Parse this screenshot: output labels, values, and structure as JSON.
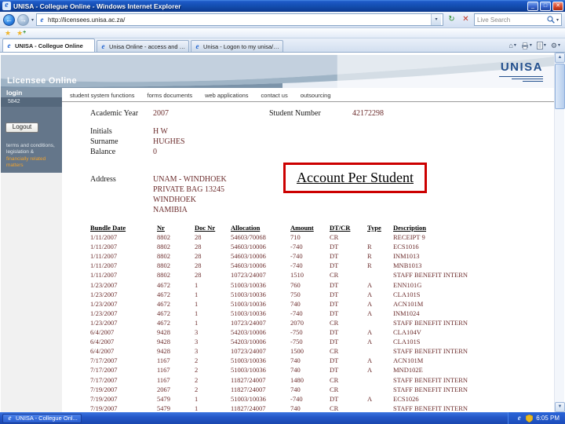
{
  "window": {
    "title": "UNISA - Collegue Online - Windows Internet Explorer"
  },
  "icons": {
    "minimize": "_",
    "maximize": "□",
    "close": "✕",
    "back": "←",
    "forward": "→",
    "dropdown": "▾",
    "refresh": "↻",
    "stop": "✕",
    "star": "★",
    "plus": "+",
    "home": "⌂",
    "gear": "⚙",
    "up": "▲",
    "down": "▼",
    "ie": "e"
  },
  "chrome": {
    "url": "http://licensees.unisa.ac.za/",
    "search_placeholder": "Live Search",
    "tabs": [
      {
        "label": "UNISA - Collegue Online",
        "active": true
      },
      {
        "label": "Unisa Online - access and regist...",
        "active": false
      },
      {
        "label": "Unisa - Logon to my unisa/colle...",
        "active": false
      }
    ]
  },
  "banner": {
    "site_title": "Licensee Online",
    "logo_text": "UNISA"
  },
  "sidebar": {
    "login_label": "login",
    "user_code": "5842",
    "logout_label": "Logout",
    "terms_line1": "terms and conditions,",
    "terms_line2": "legislation &",
    "terms_link": "financially related matters"
  },
  "nav": {
    "items": [
      "student system functions",
      "forms documents",
      "web applications",
      "contact us",
      "outsourcing"
    ]
  },
  "student": {
    "academic_year_label": "Academic Year",
    "academic_year": "2007",
    "student_number_label": "Student Number",
    "student_number": "42172298",
    "initials_label": "Initials",
    "initials": "H W",
    "surname_label": "Surname",
    "surname": "HUGHES",
    "balance_label": "Balance",
    "balance": "0",
    "address_label": "Address",
    "address_lines": [
      "UNAM - WINDHOEK",
      "PRIVATE BAG 13245",
      "WINDHOEK",
      "NAMIBIA"
    ]
  },
  "account_title": "Account Per Student",
  "table": {
    "headers": [
      "Bundle Date",
      "Nr",
      "Doc Nr",
      "Allocation",
      "Amount",
      "DT/CR",
      "Type",
      "Description"
    ],
    "rows": [
      [
        "1/11/2007",
        "8802",
        "28",
        "54603/70068",
        "710",
        "CR",
        "",
        "RECEIPT 9"
      ],
      [
        "1/11/2007",
        "8802",
        "28",
        "54603/10006",
        "-740",
        "DT",
        "R",
        "ECS1016"
      ],
      [
        "1/11/2007",
        "8802",
        "28",
        "54603/10006",
        "-740",
        "DT",
        "R",
        "INM1013"
      ],
      [
        "1/11/2007",
        "8802",
        "28",
        "54603/10006",
        "-740",
        "DT",
        "R",
        "MNB1013"
      ],
      [
        "1/11/2007",
        "8802",
        "28",
        "10723/24007",
        "1510",
        "CR",
        "",
        "STAFF BENEFIT INTERN"
      ],
      [
        "1/23/2007",
        "4672",
        "1",
        "51003/10036",
        "760",
        "DT",
        "A",
        "ENN101G"
      ],
      [
        "1/23/2007",
        "4672",
        "1",
        "51003/10036",
        "750",
        "DT",
        "A",
        "CLA101S"
      ],
      [
        "1/23/2007",
        "4672",
        "1",
        "51003/10036",
        "740",
        "DT",
        "A",
        "ACN101M"
      ],
      [
        "1/23/2007",
        "4672",
        "1",
        "51003/10036",
        "-740",
        "DT",
        "A",
        "INM1024"
      ],
      [
        "1/23/2007",
        "4672",
        "1",
        "10723/24007",
        "2070",
        "CR",
        "",
        "STAFF BENEFIT INTERN"
      ],
      [
        "6/4/2007",
        "9428",
        "3",
        "54203/10006",
        "-750",
        "DT",
        "A",
        "CLA104V"
      ],
      [
        "6/4/2007",
        "9428",
        "3",
        "54203/10006",
        "-750",
        "DT",
        "A",
        "CLA101S"
      ],
      [
        "6/4/2007",
        "9428",
        "3",
        "10723/24007",
        "1500",
        "CR",
        "",
        "STAFF BENEFIT INTERN"
      ],
      [
        "7/17/2007",
        "1167",
        "2",
        "51003/10036",
        "740",
        "DT",
        "A",
        "ACN101M"
      ],
      [
        "7/17/2007",
        "1167",
        "2",
        "51003/10036",
        "740",
        "DT",
        "A",
        "MND102E"
      ],
      [
        "7/17/2007",
        "1167",
        "2",
        "11827/24007",
        "1480",
        "CR",
        "",
        "STAFF BENEFIT INTERN"
      ],
      [
        "7/19/2007",
        "2067",
        "2",
        "11827/24007",
        "740",
        "CR",
        "",
        "STAFF BENEFIT INTERN"
      ],
      [
        "7/19/2007",
        "5479",
        "1",
        "51003/10036",
        "-740",
        "DT",
        "A",
        "ECS1026"
      ],
      [
        "7/19/2007",
        "5479",
        "1",
        "11827/24007",
        "740",
        "CR",
        "",
        "STAFF BENEFIT INTERN"
      ]
    ]
  },
  "taskbar": {
    "task_label": "UNISA - Collegue Onl...",
    "time": "6:05 PM"
  }
}
